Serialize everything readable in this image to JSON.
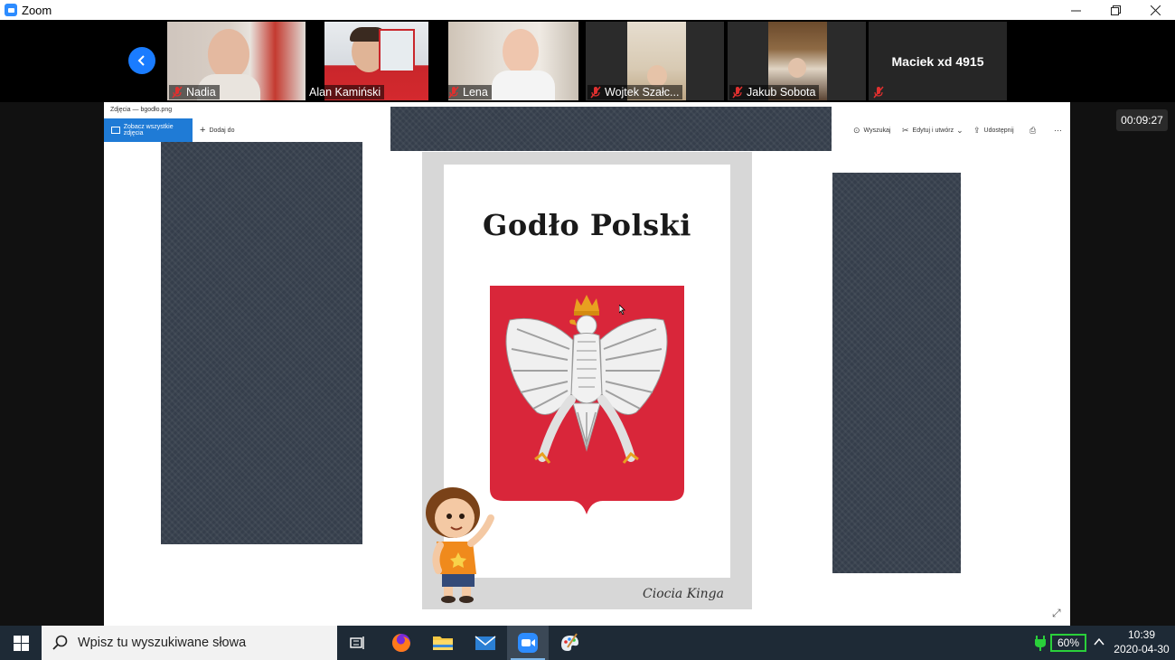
{
  "window": {
    "title": "Zoom"
  },
  "gallery": {
    "participants": [
      {
        "name": "Nadia",
        "muted": true
      },
      {
        "name": "Alan Kamiński",
        "muted": false
      },
      {
        "name": "Lena",
        "muted": true
      },
      {
        "name": "Wojtek Szałc...",
        "muted": true
      },
      {
        "name": "Jakub Sobota",
        "muted": true
      },
      {
        "name": "Maciek xd 4915",
        "muted": true
      }
    ]
  },
  "meeting": {
    "timer": "00:09:27"
  },
  "photos_app": {
    "title": "Zdjęcia — bgodło.png",
    "see_all_label": "Zobacz wszystkie zdjęcia",
    "add_to_label": "Dodaj do",
    "search_label": "Wyszukaj",
    "edit_label": "Edytuj i utwórz",
    "share_label": "Udostępnij"
  },
  "poster": {
    "title": "Godło Polski",
    "signature": "Ciocia Kinga"
  },
  "taskbar": {
    "search_placeholder": "Wpisz tu wyszukiwane słowa",
    "battery": "60%",
    "time": "10:39",
    "date": "2020-04-30"
  },
  "colors": {
    "zoom_blue": "#2d8cff",
    "crest_red": "#d9263a",
    "taskbar": "#1e2a36",
    "muted_red": "#e0302f"
  }
}
